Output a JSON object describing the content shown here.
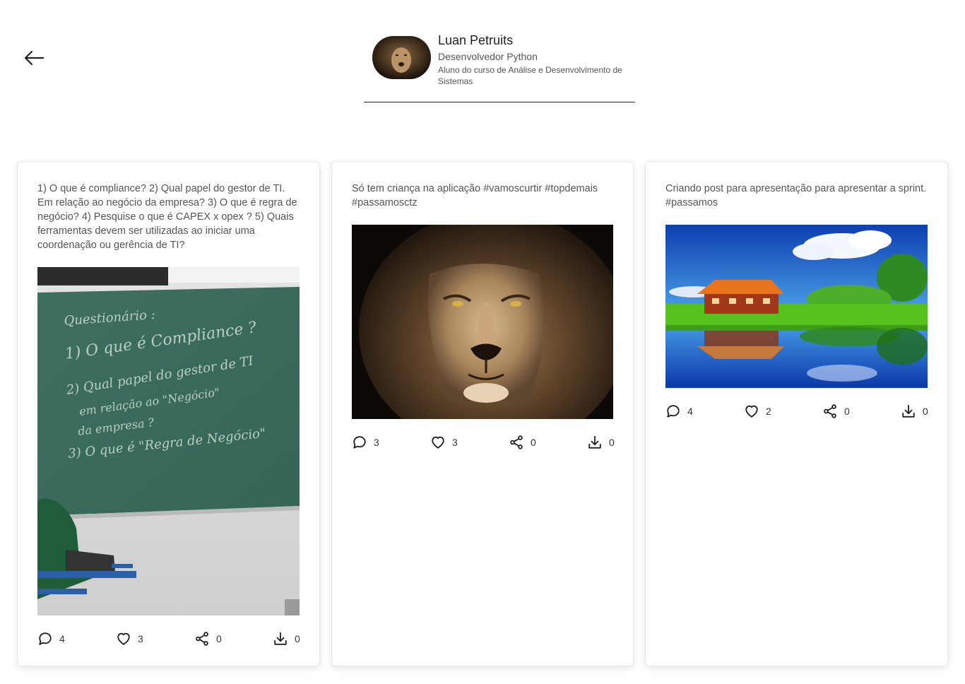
{
  "profile": {
    "name": "Luan Petruits",
    "role": "Desenvolvedor Python",
    "description": "Aluno do curso de Análise e Desenvolvimento de Sistemas"
  },
  "icons": {
    "back": "arrow-left-icon",
    "comment": "comment-icon",
    "like": "heart-icon",
    "share": "share-icon",
    "download": "download-icon"
  },
  "posts": [
    {
      "text": "1) O que é compliance? 2) Qual papel do gestor de TI. Em relação ao negócio da empresa? 3) O que é regra de negócio? 4) Pesquise o que é CAPEX x opex ? 5) Quais ferramentas devem ser utilizadas ao iniciar uma coordenação ou gerência de TI?",
      "image": "classroom-chalkboard-photo",
      "chalkboard": [
        "Questionário :",
        "1) O que é Compliance ?",
        "2) Qual papel do gestor de TI",
        "em relação ao \"Negócio\"",
        "da empresa ?",
        "3) O que é \"Regra de Negócio\""
      ],
      "comments": "4",
      "likes": "3",
      "shares": "0",
      "downloads": "0"
    },
    {
      "text": "Só tem criança na aplicação #vamoscurtir #topdemais #passamosctz",
      "image": "lion-face-photo",
      "comments": "3",
      "likes": "3",
      "shares": "0",
      "downloads": "0"
    },
    {
      "text": "Criando post para apresentação para apresentar a sprint. #passamos",
      "image": "house-lake-reflection-photo",
      "comments": "4",
      "likes": "2",
      "shares": "0",
      "downloads": "0"
    }
  ]
}
